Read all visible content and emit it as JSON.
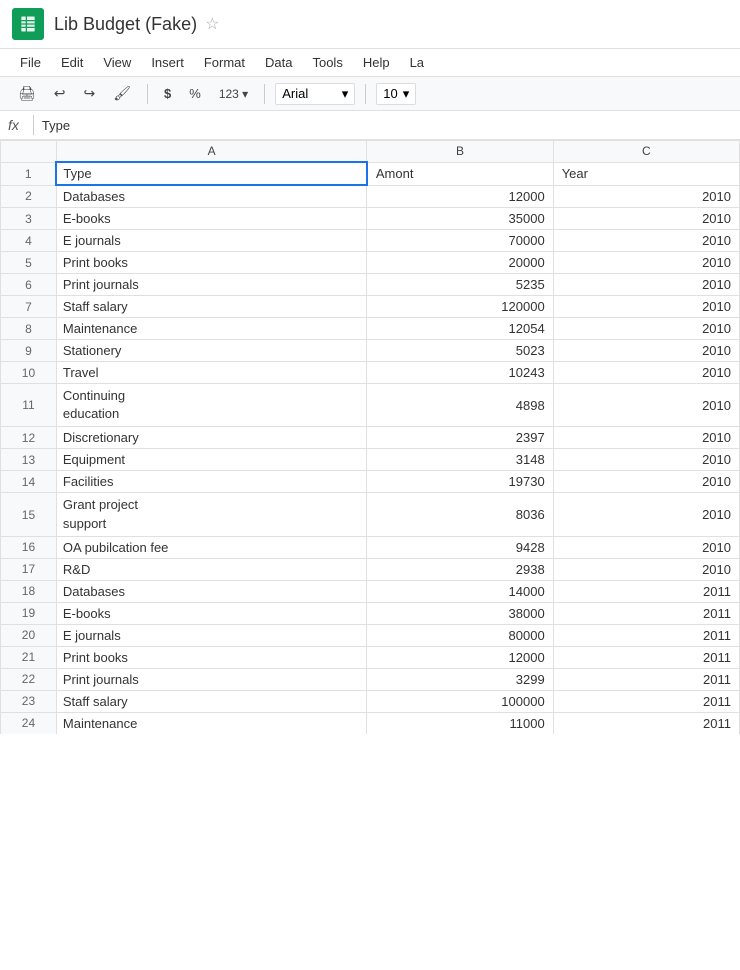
{
  "app": {
    "title": "Lib Budget (Fake)",
    "icon_label": "sheets-icon"
  },
  "menu": {
    "items": [
      "File",
      "Edit",
      "View",
      "Insert",
      "Format",
      "Data",
      "Tools",
      "Help",
      "La"
    ]
  },
  "toolbar": {
    "print_label": "🖨",
    "undo_label": "↩",
    "redo_label": "↪",
    "paint_label": "🖌",
    "currency_label": "$",
    "percent_label": "%",
    "format_label": "123 ▾",
    "font_name": "Arial",
    "font_size": "10"
  },
  "formula_bar": {
    "fx_label": "fx",
    "cell_ref": "Type"
  },
  "columns": {
    "header_row": "",
    "A": "A",
    "B": "B",
    "C": "C"
  },
  "rows": [
    {
      "num": "1",
      "A": "Type",
      "B": "Amont",
      "C": "Year",
      "A_align": "left",
      "multiline": false
    },
    {
      "num": "2",
      "A": "Databases",
      "B": "12000",
      "C": "2010",
      "A_align": "left",
      "multiline": false
    },
    {
      "num": "3",
      "A": "E-books",
      "B": "35000",
      "C": "2010",
      "A_align": "left",
      "multiline": false
    },
    {
      "num": "4",
      "A": "E journals",
      "B": "70000",
      "C": "2010",
      "A_align": "left",
      "multiline": false
    },
    {
      "num": "5",
      "A": "Print books",
      "B": "20000",
      "C": "2010",
      "A_align": "left",
      "multiline": false
    },
    {
      "num": "6",
      "A": "Print journals",
      "B": "5235",
      "C": "2010",
      "A_align": "left",
      "multiline": false
    },
    {
      "num": "7",
      "A": "Staff salary",
      "B": "120000",
      "C": "2010",
      "A_align": "left",
      "multiline": false
    },
    {
      "num": "8",
      "A": "Maintenance",
      "B": "12054",
      "C": "2010",
      "A_align": "left",
      "multiline": false
    },
    {
      "num": "9",
      "A": "Stationery",
      "B": "5023",
      "C": "2010",
      "A_align": "left",
      "multiline": false
    },
    {
      "num": "10",
      "A": "Travel",
      "B": "10243",
      "C": "2010",
      "A_align": "left",
      "multiline": false
    },
    {
      "num": "11",
      "A": "Continuing\neducation",
      "B": "4898",
      "C": "2010",
      "A_align": "left",
      "multiline": true
    },
    {
      "num": "12",
      "A": "Discretionary",
      "B": "2397",
      "C": "2010",
      "A_align": "left",
      "multiline": false
    },
    {
      "num": "13",
      "A": "Equipment",
      "B": "3148",
      "C": "2010",
      "A_align": "left",
      "multiline": false
    },
    {
      "num": "14",
      "A": "Facilities",
      "B": "19730",
      "C": "2010",
      "A_align": "left",
      "multiline": false
    },
    {
      "num": "15",
      "A": "Grant project\nsupport",
      "B": "8036",
      "C": "2010",
      "A_align": "left",
      "multiline": true
    },
    {
      "num": "16",
      "A": "OA pubilcation fee",
      "B": "9428",
      "C": "2010",
      "A_align": "left",
      "multiline": false
    },
    {
      "num": "17",
      "A": "R&D",
      "B": "2938",
      "C": "2010",
      "A_align": "left",
      "multiline": false
    },
    {
      "num": "18",
      "A": "Databases",
      "B": "14000",
      "C": "2011",
      "A_align": "left",
      "multiline": false
    },
    {
      "num": "19",
      "A": "E-books",
      "B": "38000",
      "C": "2011",
      "A_align": "left",
      "multiline": false
    },
    {
      "num": "20",
      "A": "E journals",
      "B": "80000",
      "C": "2011",
      "A_align": "left",
      "multiline": false
    },
    {
      "num": "21",
      "A": "Print books",
      "B": "12000",
      "C": "2011",
      "A_align": "left",
      "multiline": false
    },
    {
      "num": "22",
      "A": "Print journals",
      "B": "3299",
      "C": "2011",
      "A_align": "left",
      "multiline": false
    },
    {
      "num": "23",
      "A": "Staff salary",
      "B": "100000",
      "C": "2011",
      "A_align": "left",
      "multiline": false
    },
    {
      "num": "24",
      "A": "Maintenance",
      "B": "11000",
      "C": "2011",
      "A_align": "left",
      "multiline": false,
      "partial": true
    }
  ]
}
